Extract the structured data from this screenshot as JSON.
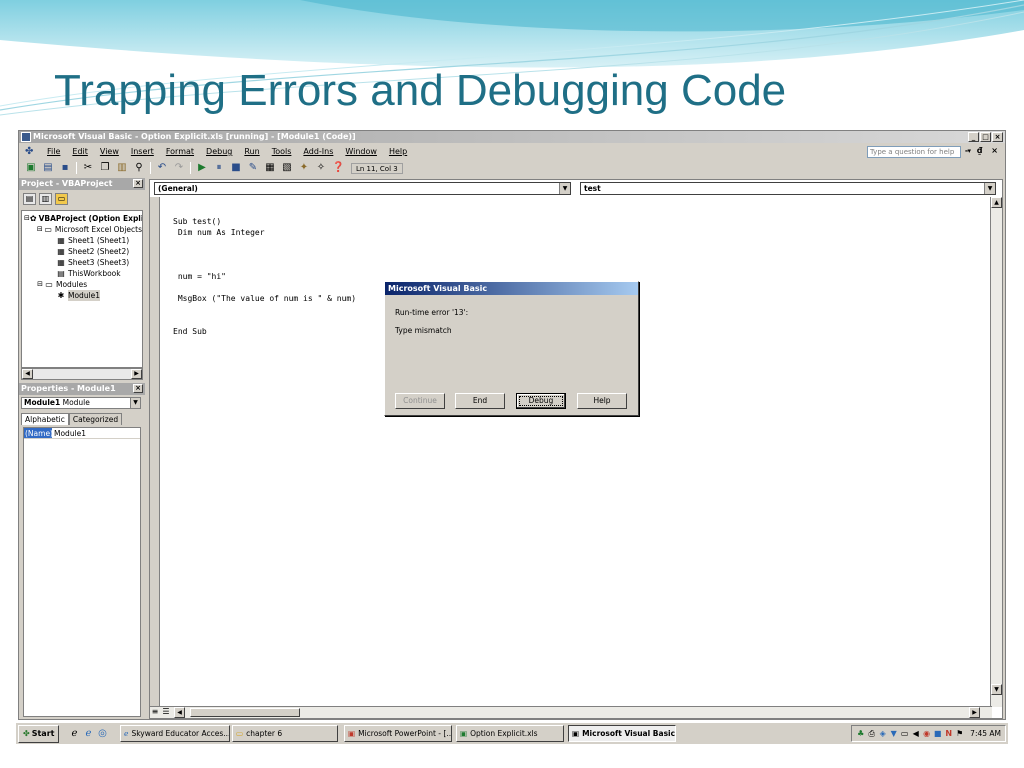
{
  "slide": {
    "title": "Trapping Errors and Debugging Code"
  },
  "window": {
    "title": "Microsoft Visual Basic - Option Explicit.xls [running] - [Module1 (Code)]",
    "buttons": [
      "_",
      "□",
      "×"
    ]
  },
  "menu": {
    "items": [
      "File",
      "Edit",
      "View",
      "Insert",
      "Format",
      "Debug",
      "Run",
      "Tools",
      "Add-Ins",
      "Window",
      "Help"
    ],
    "help_placeholder": "Type a question for help",
    "mdi_buttons": "- ₫ ×"
  },
  "toolbar": {
    "position": "Ln 11, Col 3"
  },
  "project": {
    "title": "Project - VBAProject",
    "tree": [
      {
        "label": "VBAProject (Option Expli",
        "indent": 0,
        "toggle": "⊟",
        "icon": "✿"
      },
      {
        "label": "Microsoft Excel Objects",
        "indent": 1,
        "toggle": "⊟",
        "icon": "▭"
      },
      {
        "label": "Sheet1 (Sheet1)",
        "indent": 2,
        "toggle": "",
        "icon": "▦"
      },
      {
        "label": "Sheet2 (Sheet2)",
        "indent": 2,
        "toggle": "",
        "icon": "▦"
      },
      {
        "label": "Sheet3 (Sheet3)",
        "indent": 2,
        "toggle": "",
        "icon": "▦"
      },
      {
        "label": "ThisWorkbook",
        "indent": 2,
        "toggle": "",
        "icon": "▤"
      },
      {
        "label": "Modules",
        "indent": 1,
        "toggle": "⊟",
        "icon": "▭"
      },
      {
        "label": "Module1",
        "indent": 2,
        "toggle": "",
        "icon": "✱",
        "selected": true
      }
    ]
  },
  "properties": {
    "title": "Properties - Module1",
    "object_name": "Module1",
    "object_type": "Module",
    "tabs": [
      "Alphabetic",
      "Categorized"
    ],
    "rows": [
      {
        "name": "(Name)",
        "value": "Module1"
      }
    ]
  },
  "code": {
    "object_combo": "(General)",
    "proc_combo": "test",
    "lines": [
      {
        "text": "Sub test()",
        "row": 0
      },
      {
        "text": " Dim num As Integer",
        "row": 1
      },
      {
        "text": " num = \"hi\"",
        "row": 5
      },
      {
        "text": " MsgBox (\"The value of num is \" & num)",
        "row": 7
      },
      {
        "text": "End Sub",
        "row": 10
      }
    ]
  },
  "dialog": {
    "title": "Microsoft Visual Basic",
    "error": "Run-time error '13':",
    "message": "Type mismatch",
    "buttons": {
      "continue": "Continue",
      "end": "End",
      "debug": "Debug",
      "help": "Help"
    }
  },
  "taskbar": {
    "start": "Start",
    "tasks": [
      "Skyward Educator Acces...",
      "chapter 6",
      "Microsoft PowerPoint - [...",
      "Option Explicit.xls",
      "Microsoft Visual Basic..."
    ],
    "clock": "7:45 AM"
  }
}
